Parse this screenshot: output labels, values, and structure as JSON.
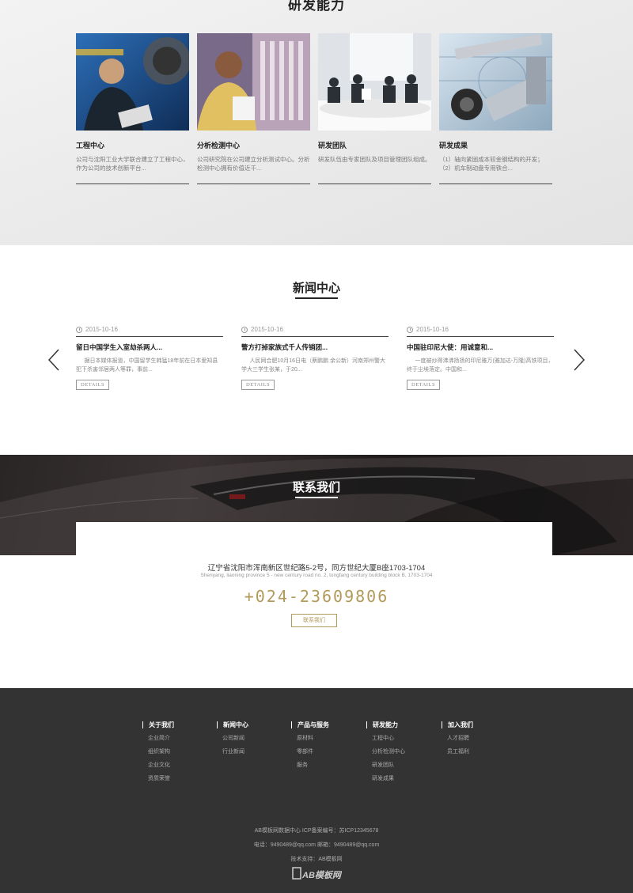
{
  "rd": {
    "title": "研发能力",
    "cards": [
      {
        "name": "工程中心",
        "desc": "公司与沈阳工业大学联合建立了工程中心，作为公司的技术创新平台..."
      },
      {
        "name": "分析检测中心",
        "desc": "公司研究院在公司建立分析测试中心。分析检测中心拥有价值近千..."
      },
      {
        "name": "研发团队",
        "desc": "研发队伍由专家团队及项目管理团队组成。"
      },
      {
        "name": "研发成果",
        "desc": "（1）轴向紧固成本较金钢结构的开发；（2）机车制动盘专用铁合..."
      }
    ]
  },
  "news": {
    "title": "新闻中心",
    "items": [
      {
        "date": "2015-10-16",
        "headline": "留日中国学生入室劫杀两人...",
        "body": "据日本媒体报道，中国留学生韩猛18年前在日本爱知县犯下杀害邻居两人等罪，事前...",
        "button": "DETAILS"
      },
      {
        "date": "2015-10-16",
        "headline": "警方打掉家族式千人传销团...",
        "body": "人民网合肥10月16日电（蔡鹏鹏 余公新）河南郑州警大学大三学生张某，于20...",
        "button": "DETAILS"
      },
      {
        "date": "2015-10-16",
        "headline": "中国驻印尼大使：用诚意和...",
        "body": "一度被炒得沸沸扬扬的印尼雅万(雅加达-万隆)高铁项目，终于尘埃落定。中国和...",
        "button": "DETAILS"
      }
    ]
  },
  "contact": {
    "title": "联系我们",
    "address": "辽宁省沈阳市浑南新区世纪路5-2号，同方世纪大厦B座1703-1704",
    "address_en": "Shenyang, liaoning province 5 - new century road no. 2, tongfang century building block B, 1703-1704",
    "phone": "+024-23609806",
    "button": "联系我们"
  },
  "footer": {
    "columns": [
      {
        "title": "关于我们",
        "items": [
          "企业简介",
          "组织架构",
          "企业文化",
          "资质荣誉"
        ]
      },
      {
        "title": "新闻中心",
        "items": [
          "公司新闻",
          "行业新闻"
        ]
      },
      {
        "title": "产品与服务",
        "items": [
          "原材料",
          "零部件",
          "服务"
        ]
      },
      {
        "title": "研发能力",
        "items": [
          "工程中心",
          "分析检测中心",
          "研发团队",
          "研发成果"
        ]
      },
      {
        "title": "加入我们",
        "items": [
          "人才招聘",
          "员工福利"
        ]
      }
    ],
    "copyright": "AB模板网数据中心 ICP备案编号：苏ICP12345678",
    "contact_line": "电话：9490489@qq.com 邮箱：9490489@qq.com",
    "support": "技术支持：AB模板网",
    "logo_text": "AB模板网"
  },
  "colors": {
    "accent_gold": "#b29a5a",
    "footer_bg": "#333333"
  }
}
